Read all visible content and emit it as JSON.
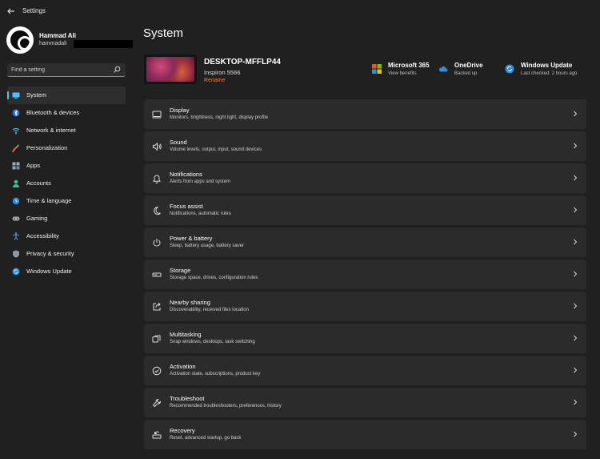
{
  "window": {
    "title": "Settings"
  },
  "profile": {
    "name": "Hammad Ali",
    "email": "hammadali"
  },
  "search": {
    "placeholder": "Find a setting"
  },
  "nav": {
    "items": [
      {
        "label": "System",
        "icon": "system-icon",
        "active": true
      },
      {
        "label": "Bluetooth & devices",
        "icon": "bluetooth-icon"
      },
      {
        "label": "Network & internet",
        "icon": "wifi-icon"
      },
      {
        "label": "Personalization",
        "icon": "brush-icon"
      },
      {
        "label": "Apps",
        "icon": "apps-icon"
      },
      {
        "label": "Accounts",
        "icon": "accounts-icon"
      },
      {
        "label": "Time & language",
        "icon": "globe-clock-icon"
      },
      {
        "label": "Gaming",
        "icon": "gamepad-icon"
      },
      {
        "label": "Accessibility",
        "icon": "accessibility-icon"
      },
      {
        "label": "Privacy & security",
        "icon": "shield-icon"
      },
      {
        "label": "Windows Update",
        "icon": "windows-update-icon"
      }
    ]
  },
  "main": {
    "title": "System",
    "device": {
      "name": "DESKTOP-MFFLP44",
      "model": "Inspiron 5566",
      "rename": "Rename"
    },
    "quick": [
      {
        "title": "Microsoft 365",
        "subtitle": "View benefits",
        "icon": "microsoft-logo-icon"
      },
      {
        "title": "OneDrive",
        "subtitle": "Backed up",
        "icon": "cloud-icon"
      },
      {
        "title": "Windows Update",
        "subtitle": "Last checked: 2 hours ago",
        "icon": "windows-update-icon"
      }
    ],
    "rows": [
      {
        "title": "Display",
        "subtitle": "Monitors, brightness, night light, display profile",
        "icon": "monitor-icon"
      },
      {
        "title": "Sound",
        "subtitle": "Volume levels, output, input, sound devices",
        "icon": "speaker-icon"
      },
      {
        "title": "Notifications",
        "subtitle": "Alerts from apps and system",
        "icon": "bell-icon"
      },
      {
        "title": "Focus assist",
        "subtitle": "Notifications, automatic rules",
        "icon": "moon-icon"
      },
      {
        "title": "Power & battery",
        "subtitle": "Sleep, battery usage, battery saver",
        "icon": "power-icon"
      },
      {
        "title": "Storage",
        "subtitle": "Storage space, drives, configuration rules",
        "icon": "storage-icon"
      },
      {
        "title": "Nearby sharing",
        "subtitle": "Discoverability, received files location",
        "icon": "share-icon"
      },
      {
        "title": "Multitasking",
        "subtitle": "Snap windows, desktops, task switching",
        "icon": "multitask-icon"
      },
      {
        "title": "Activation",
        "subtitle": "Activation state, subscriptions, product key",
        "icon": "check-circle-icon"
      },
      {
        "title": "Troubleshoot",
        "subtitle": "Recommended troubleshooters, preferences, history",
        "icon": "wrench-icon"
      },
      {
        "title": "Recovery",
        "subtitle": "Reset, advanced startup, go back",
        "icon": "recovery-icon"
      }
    ]
  },
  "colors": {
    "background": "#202020",
    "card": "#2b2b2b",
    "accent": "#4cc2ff",
    "rename": "#f08040"
  }
}
